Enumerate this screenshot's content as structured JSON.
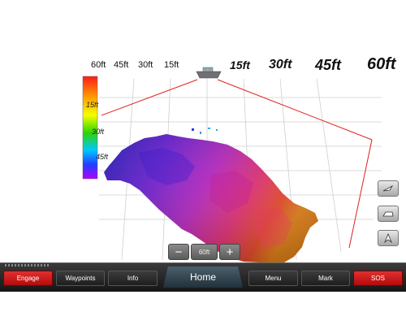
{
  "distance_scale": {
    "left": [
      "60ft",
      "45ft",
      "30ft",
      "15ft"
    ],
    "right": [
      "15ft",
      "30ft",
      "45ft",
      "60ft"
    ]
  },
  "depth_scale": [
    "15ft",
    "30ft",
    "45ft"
  ],
  "zoom": {
    "minus": "−",
    "level": "60ft",
    "plus": "+"
  },
  "side_buttons": [
    "view-angle-icon",
    "pan-icon",
    "north-up-icon"
  ],
  "bottom_bar": {
    "engage": "Engage",
    "waypoints": "Waypoints",
    "info": "Info",
    "home": "Home",
    "menu": "Menu",
    "mark": "Mark",
    "sos": "SOS"
  },
  "colors": {
    "grid_red": "#e02020",
    "red_button": "#d01818",
    "bar": "#202020"
  }
}
